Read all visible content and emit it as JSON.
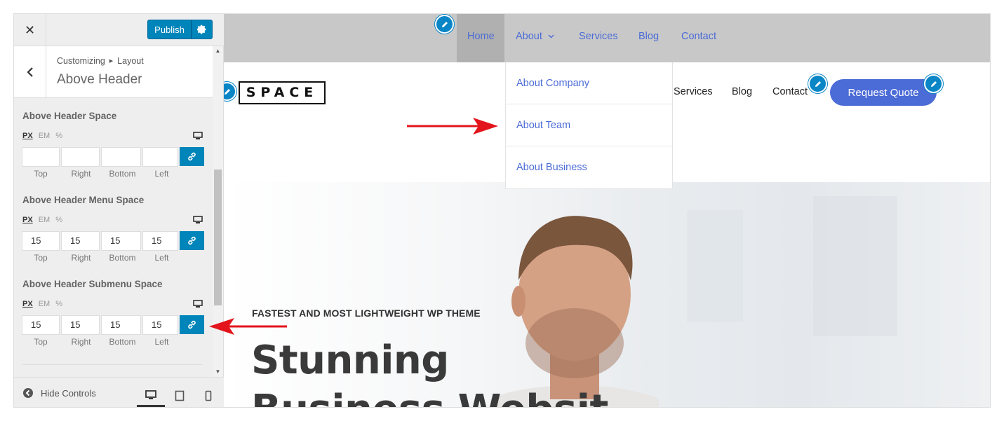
{
  "sidebar": {
    "publish_label": "Publish",
    "breadcrumb": [
      "Customizing",
      "Layout"
    ],
    "section_title": "Above Header",
    "controls": [
      {
        "title": "Above Header Space",
        "units": [
          "PX",
          "EM",
          "%"
        ],
        "values": [
          "",
          "",
          "",
          ""
        ],
        "labels": [
          "Top",
          "Right",
          "Bottom",
          "Left"
        ]
      },
      {
        "title": "Above Header Menu Space",
        "units": [
          "PX",
          "EM",
          "%"
        ],
        "values": [
          "15",
          "15",
          "15",
          "15"
        ],
        "labels": [
          "Top",
          "Right",
          "Bottom",
          "Left"
        ]
      },
      {
        "title": "Above Header Submenu Space",
        "units": [
          "PX",
          "EM",
          "%"
        ],
        "values": [
          "15",
          "15",
          "15",
          "15"
        ],
        "labels": [
          "Top",
          "Right",
          "Bottom",
          "Left"
        ]
      }
    ],
    "footer": {
      "hide_controls": "Hide Controls"
    }
  },
  "preview": {
    "above_header_menu": [
      "Home",
      "About",
      "Services",
      "Blog",
      "Contact"
    ],
    "submenu": [
      "About Company",
      "About Team",
      "About Business"
    ],
    "logo": "SPACE",
    "main_nav": [
      "Services",
      "Blog",
      "Contact"
    ],
    "request_button": "Request Quote",
    "hero": {
      "tagline": "FASTEST AND MOST LIGHTWEIGHT WP THEME",
      "title_line1": "Stunning",
      "title_line2": "Business Websit"
    }
  },
  "colors": {
    "wp_blue": "#0085ba",
    "link_blue": "#4b6bd6",
    "arrow_red": "#e3141b",
    "above_header_bg": "#c8c8c8"
  },
  "icons": [
    "close-icon",
    "gear-icon",
    "back-chevron-icon",
    "desktop-icon",
    "link-icon",
    "pencil-icon",
    "chevron-down-icon",
    "hide-controls-icon",
    "tablet-icon",
    "mobile-icon"
  ]
}
